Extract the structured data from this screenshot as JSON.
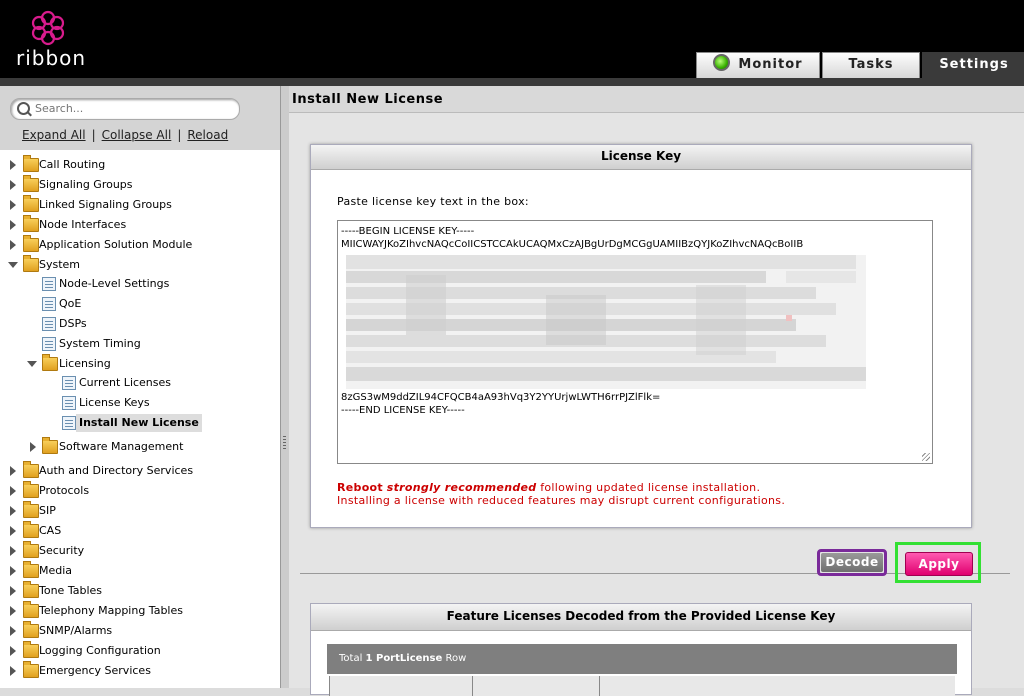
{
  "brand": {
    "name": "ribbon",
    "accent": "#e0006e"
  },
  "tabs": [
    {
      "label": "Monitor",
      "icon": "status-ok-icon"
    },
    {
      "label": "Tasks"
    },
    {
      "label": "Settings",
      "active": true
    }
  ],
  "sidebar": {
    "search_placeholder": "Search...",
    "links": {
      "expand": "Expand All",
      "collapse": "Collapse All",
      "reload": "Reload"
    },
    "tree": [
      {
        "label": "Call Routing"
      },
      {
        "label": "Signaling Groups"
      },
      {
        "label": "Linked Signaling Groups"
      },
      {
        "label": "Node Interfaces"
      },
      {
        "label": "Application Solution Module"
      },
      {
        "label": "System",
        "expanded": true
      },
      {
        "label": "Node-Level Settings"
      },
      {
        "label": "QoE"
      },
      {
        "label": "DSPs"
      },
      {
        "label": "System Timing"
      },
      {
        "label": "Licensing",
        "expanded": true
      },
      {
        "label": "Current Licenses"
      },
      {
        "label": "License Keys"
      },
      {
        "label": "Install New License",
        "selected": true
      },
      {
        "label": "Software Management"
      },
      {
        "label": "Auth and Directory Services"
      },
      {
        "label": "Protocols"
      },
      {
        "label": "SIP"
      },
      {
        "label": "CAS"
      },
      {
        "label": "Security"
      },
      {
        "label": "Media"
      },
      {
        "label": "Tone Tables"
      },
      {
        "label": "Telephony Mapping Tables"
      },
      {
        "label": "SNMP/Alarms"
      },
      {
        "label": "Logging Configuration"
      },
      {
        "label": "Emergency Services"
      }
    ]
  },
  "main": {
    "title": "Install New License",
    "license_panel": {
      "title": "License Key",
      "instruction": "Paste license key text in the box:",
      "key_lines": [
        "-----BEGIN LICENSE KEY-----",
        "MIICWAYJKoZIhvcNAQcCoIICSTCCAkUCAQMxCzAJBgUrDgMCGgUAMIIBzQYJKoZIhvcNAQcBoIIB",
        "8zGS3wM9ddZIL94CFQCB4aA93hVq3Y2YYUrjwLWTH6rrPJZlFlk=",
        "-----END LICENSE KEY-----"
      ],
      "warning_prefix": "Reboot",
      "warning_emphasis": "strongly recommended",
      "warning_suffix": "following updated license installation.",
      "warning_line2": "Installing a license with reduced features may disrupt current configurations."
    },
    "buttons": {
      "decode": "Decode",
      "apply": "Apply"
    },
    "decoded_panel": {
      "title": "Feature Licenses Decoded from the Provided License Key",
      "total_prefix": "Total",
      "total_count": "1 PortLicense",
      "total_suffix": "Row"
    }
  }
}
